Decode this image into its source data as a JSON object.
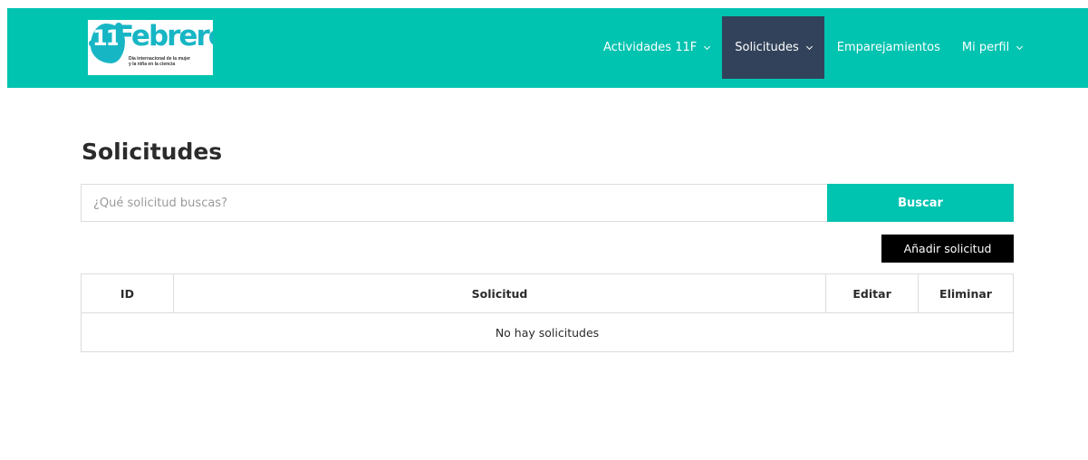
{
  "header": {
    "logo": {
      "number": "11",
      "word": "Febrero",
      "subtitle_line1": "Día internacional de la mujer",
      "subtitle_line2": "y la niña en la ciencia"
    },
    "nav": [
      {
        "label": "Actividades 11F",
        "has_dropdown": true
      },
      {
        "label": "Solicitudes",
        "has_dropdown": true,
        "active": true
      },
      {
        "label": "Emparejamientos",
        "has_dropdown": false
      },
      {
        "label": "Mi perfil",
        "has_dropdown": true
      }
    ]
  },
  "main": {
    "title": "Solicitudes",
    "search": {
      "placeholder": "¿Qué solicitud buscas?",
      "value": "",
      "button_label": "Buscar"
    },
    "add_button_label": "Añadir solicitud",
    "table": {
      "columns": [
        "ID",
        "Solicitud",
        "Editar",
        "Eliminar"
      ],
      "empty_message": "No hay solicitudes"
    }
  },
  "colors": {
    "primary": "#00c3b0",
    "nav_active": "#32425a",
    "logo_accent": "#17b6c4"
  }
}
